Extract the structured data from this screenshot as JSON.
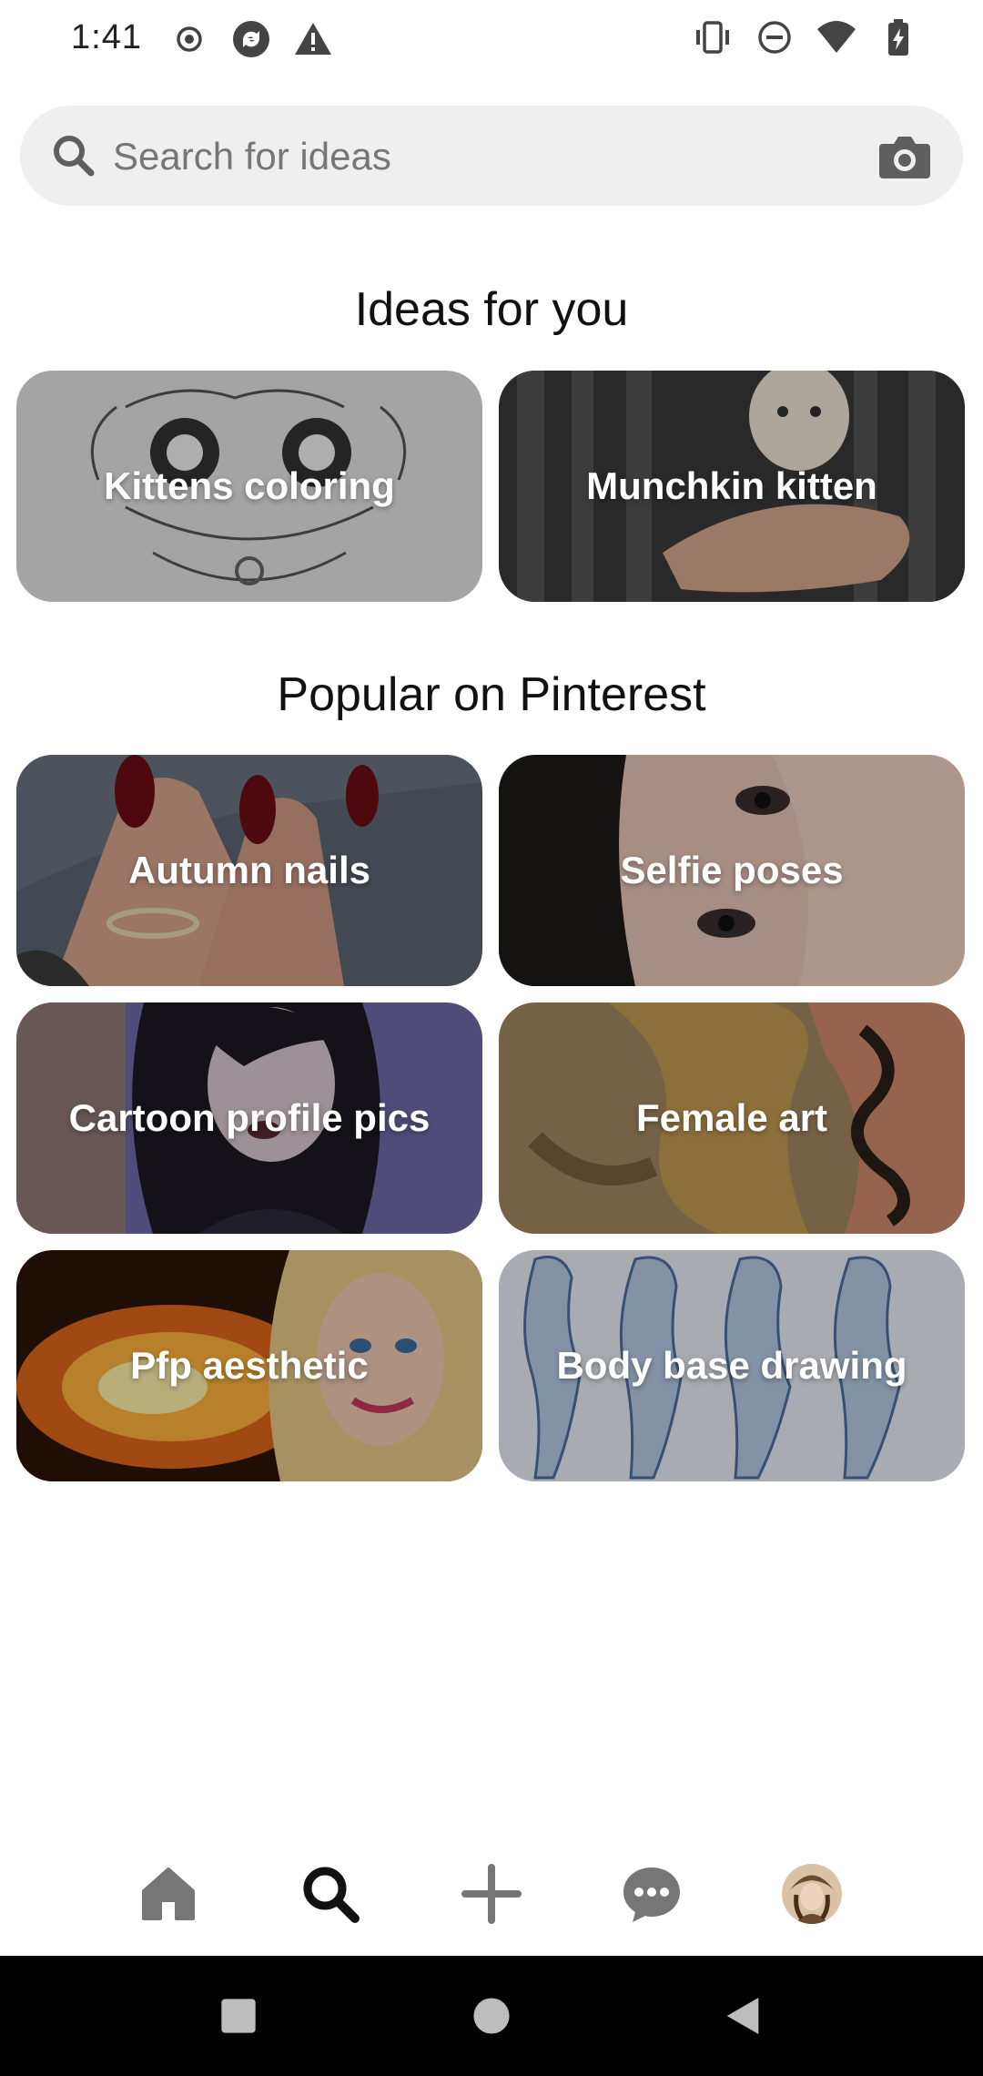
{
  "status_bar": {
    "time": "1:41",
    "left_icons": [
      "record-icon",
      "sync-app-icon",
      "warning-icon"
    ],
    "right_icons": [
      "vibrate-icon",
      "do-not-disturb-icon",
      "wifi-icon",
      "battery-charging-icon"
    ]
  },
  "search": {
    "placeholder": "Search for ideas",
    "value": ""
  },
  "sections": {
    "ideas_title": "Ideas for you",
    "popular_title": "Popular on Pinterest"
  },
  "ideas": [
    {
      "label": "Kittens coloring"
    },
    {
      "label": "Munchkin kitten"
    }
  ],
  "popular": [
    {
      "label": "Autumn nails"
    },
    {
      "label": "Selfie poses"
    },
    {
      "label": "Cartoon profile pics"
    },
    {
      "label": "Female art"
    },
    {
      "label": "Pfp aesthetic"
    },
    {
      "label": "Body base drawing"
    }
  ],
  "bottom_nav": {
    "items": [
      "home-icon",
      "search-icon",
      "create-plus-icon",
      "messages-icon",
      "profile-avatar"
    ],
    "active": "search-icon"
  },
  "system_nav": [
    "recents-button",
    "home-button",
    "back-button"
  ],
  "colors": {
    "background": "#ffffff",
    "search_bg": "#efefef",
    "placeholder": "#767676",
    "nav_icon": "#767676",
    "nav_active": "#111111",
    "system_nav_bg": "#000000"
  }
}
